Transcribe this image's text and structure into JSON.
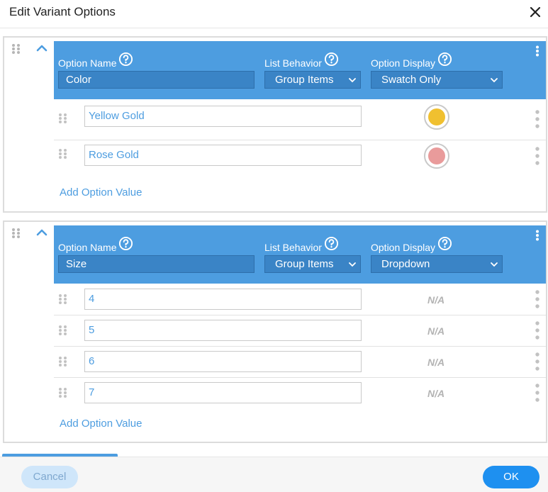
{
  "dialog": {
    "title": "Edit Variant Options",
    "close_icon": "close-icon"
  },
  "colors": {
    "accent": "#4d9de0",
    "header_input": "#3a84c6",
    "ok_button": "#1e90f0",
    "cancel_button": "#cfe6fa"
  },
  "options": [
    {
      "name_label": "Option Name",
      "name_value": "Color",
      "behavior_label": "List Behavior",
      "behavior_value": "Group Items",
      "display_label": "Option Display",
      "display_value": "Swatch Only",
      "values": [
        {
          "label": "Yellow Gold",
          "swatch": "#f0c030"
        },
        {
          "label": "Rose Gold",
          "swatch": "#e99b9b"
        }
      ],
      "add_label": "Add Option Value"
    },
    {
      "name_label": "Option Name",
      "name_value": "Size",
      "behavior_label": "List Behavior",
      "behavior_value": "Group Items",
      "display_label": "Option Display",
      "display_value": "Dropdown",
      "values": [
        {
          "label": "4",
          "na": "N/A"
        },
        {
          "label": "5",
          "na": "N/A"
        },
        {
          "label": "6",
          "na": "N/A"
        },
        {
          "label": "7",
          "na": "N/A"
        }
      ],
      "add_label": "Add Option Value"
    }
  ],
  "footer": {
    "cancel_label": "Cancel",
    "ok_label": "OK"
  }
}
